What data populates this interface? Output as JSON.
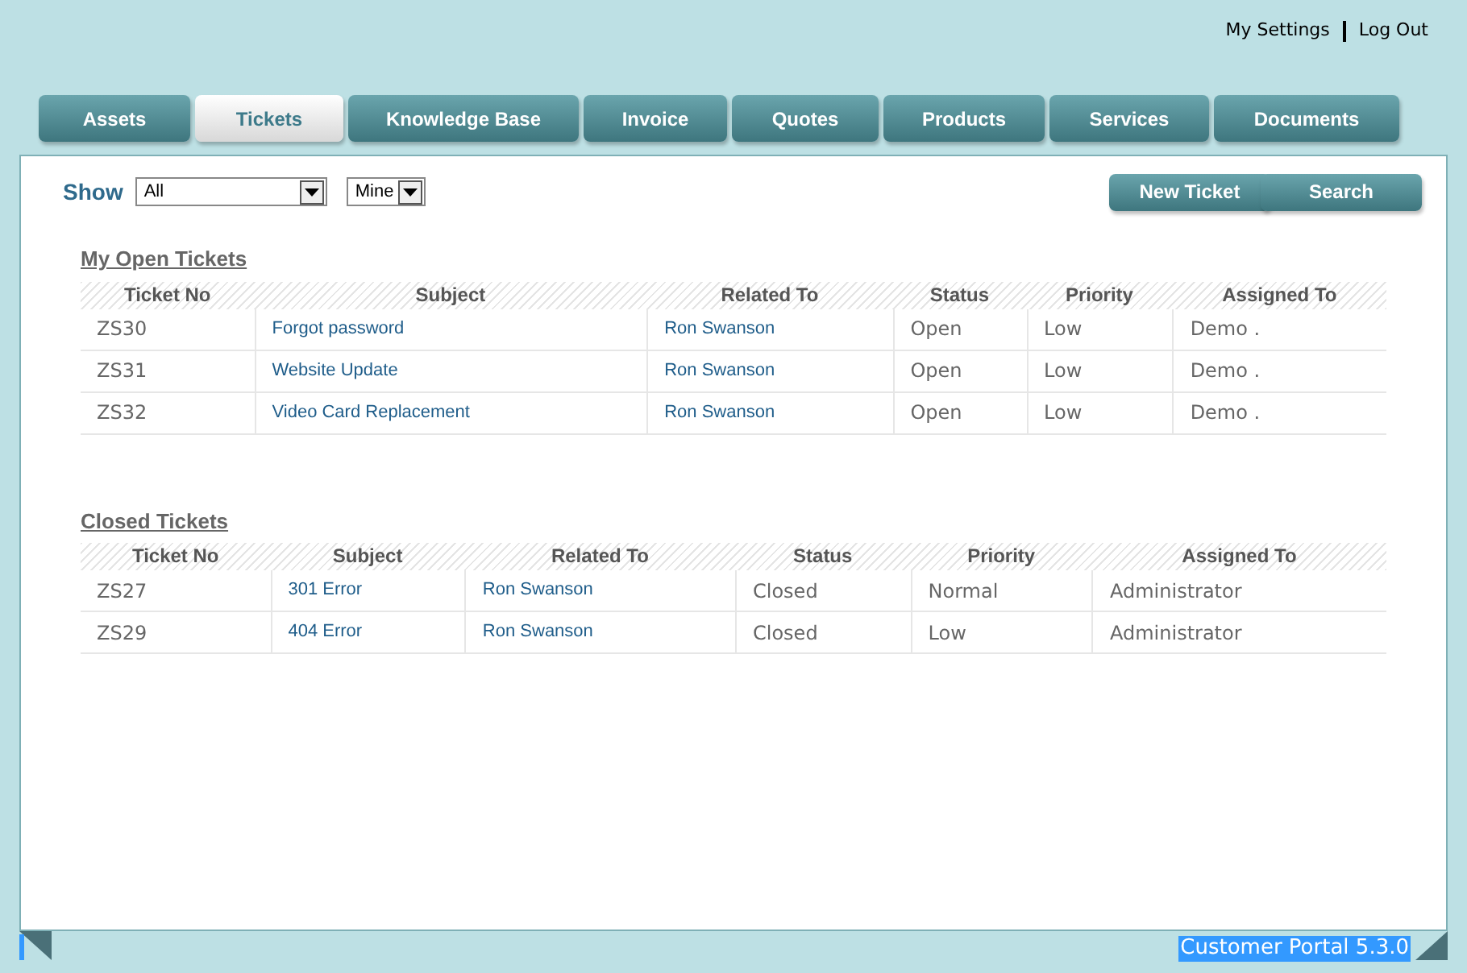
{
  "top_links": [
    "My Settings",
    "Log Out"
  ],
  "tabs": [
    {
      "label": "Assets",
      "selected": false
    },
    {
      "label": "Tickets",
      "selected": true
    },
    {
      "label": "Knowledge Base",
      "selected": false
    },
    {
      "label": "Invoice",
      "selected": false
    },
    {
      "label": "Quotes",
      "selected": false
    },
    {
      "label": "Products",
      "selected": false
    },
    {
      "label": "Services",
      "selected": false
    },
    {
      "label": "Documents",
      "selected": false
    }
  ],
  "filter": {
    "label": "Show",
    "scope": "All",
    "owner": "Mine"
  },
  "buttons": [
    "New Ticket",
    "Search"
  ],
  "tables": [
    {
      "title": "My Open Tickets",
      "columns": [
        {
          "label": "Ticket No",
          "kind": "text"
        },
        {
          "label": "Subject",
          "kind": "link"
        },
        {
          "label": "Related To",
          "kind": "link"
        },
        {
          "label": "Status",
          "kind": "text"
        },
        {
          "label": "Priority",
          "kind": "text"
        },
        {
          "label": "Assigned To",
          "kind": "text"
        }
      ],
      "rows": [
        [
          "ZS30",
          "Forgot password",
          "Ron Swanson",
          "Open",
          "Low",
          "Demo ."
        ],
        [
          "ZS31",
          "Website Update",
          "Ron Swanson",
          "Open",
          "Low",
          "Demo ."
        ],
        [
          "ZS32",
          "Video Card Replacement",
          "Ron Swanson",
          "Open",
          "Low",
          "Demo ."
        ]
      ]
    },
    {
      "title": "Closed Tickets",
      "columns": [
        {
          "label": "Ticket No",
          "kind": "text"
        },
        {
          "label": "Subject",
          "kind": "link"
        },
        {
          "label": "Related To",
          "kind": "link"
        },
        {
          "label": "Status",
          "kind": "text"
        },
        {
          "label": "Priority",
          "kind": "text"
        },
        {
          "label": "Assigned To",
          "kind": "text"
        }
      ],
      "rows": [
        [
          "ZS27",
          "301 Error",
          "Ron Swanson",
          "Closed",
          "Normal",
          "Administrator"
        ],
        [
          "ZS29",
          "404 Error",
          "Ron Swanson",
          "Closed",
          "Low",
          "Administrator"
        ]
      ]
    }
  ],
  "version": "Customer Portal 5.3.0"
}
